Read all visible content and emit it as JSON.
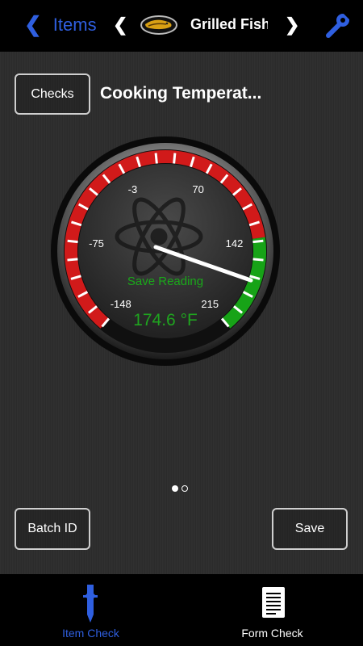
{
  "header": {
    "back_label": "Items",
    "back_chevron": "❮",
    "prev_arrow": "❮",
    "next_arrow": "❯",
    "item_title": "Grilled Fish"
  },
  "check": {
    "checks_button": "Checks",
    "title": "Cooking Temperat..."
  },
  "gauge": {
    "tick_labels": [
      "-148",
      "-75",
      "-3",
      "70",
      "142",
      "215"
    ],
    "save_reading_label": "Save Reading",
    "reading": "174.6 °F",
    "value": 174.6,
    "unit": "°F",
    "range": [
      -148,
      215
    ],
    "colors": {
      "danger": "#d11a1a",
      "ok": "#17a317"
    }
  },
  "pager": {
    "count": 2,
    "active_index": 0
  },
  "actions": {
    "batch_id": "Batch ID",
    "save": "Save"
  },
  "tabs": [
    {
      "label": "Item Check",
      "icon": "dropper-icon",
      "active": true
    },
    {
      "label": "Form Check",
      "icon": "form-icon",
      "active": false
    }
  ],
  "colors": {
    "accent": "#2f5fe0"
  }
}
